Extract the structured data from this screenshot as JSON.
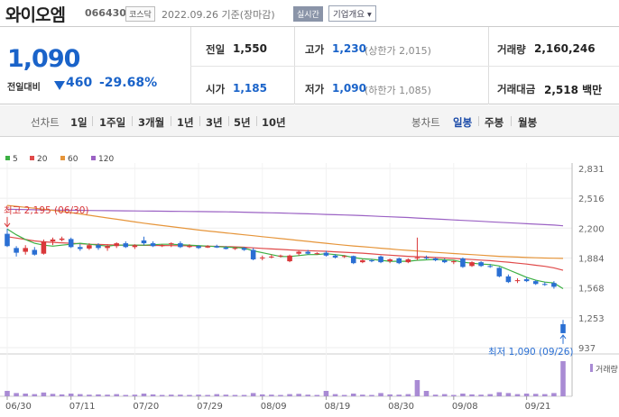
{
  "header": {
    "stock_name": "와이오엠",
    "stock_code": "066430",
    "market": "코스닥",
    "trade_date": "2022.09.26 기준(장마감)",
    "realtime_label": "실시간",
    "overview_label": "기업개요 ▾"
  },
  "quote": {
    "price": "1,090",
    "change_label": "전일대비",
    "change_amount": "460",
    "change_rate": "-29.68%",
    "prev_close_label": "전일",
    "prev_close": "1,550",
    "high_label": "고가",
    "high": "1,230",
    "upper_limit": "(상한가 2,015)",
    "volume_label": "거래량",
    "volume": "2,160,246",
    "open_label": "시가",
    "open": "1,185",
    "low_label": "저가",
    "low": "1,090",
    "lower_limit": "(하한가 1,085)",
    "trade_value_label": "거래대금",
    "trade_value": "2,518 백만"
  },
  "toolbar": {
    "line_chart_label": "선차트",
    "periods": [
      "1일",
      "1주일",
      "3개월",
      "1년",
      "3년",
      "5년",
      "10년"
    ],
    "candle_chart_label": "봉차트",
    "candle_periods": [
      "일봉",
      "주봉",
      "월봉"
    ],
    "active_candle_period": "일봉"
  },
  "colors": {
    "up": "#d9383a",
    "down": "#2a6fd3",
    "ma5": "#3cb043",
    "ma20": "#e04a4a",
    "ma60": "#e6953a",
    "ma120": "#9b62c4",
    "volume": "#a98bd4",
    "accent": "#1a63c9"
  },
  "chart_data": {
    "type": "candlestick",
    "legend": [
      {
        "name": "5",
        "color": "#3cb043"
      },
      {
        "name": "20",
        "color": "#e04a4a"
      },
      {
        "name": "60",
        "color": "#e6953a"
      },
      {
        "name": "120",
        "color": "#9b62c4"
      }
    ],
    "ylim": [
      937,
      2831
    ],
    "y_ticks": [
      "2,831",
      "2,516",
      "2,200",
      "1,884",
      "1,568",
      "1,253",
      "937"
    ],
    "y_tick_values": [
      2831,
      2516,
      2200,
      1884,
      1568,
      1253,
      937
    ],
    "x_tick_labels": [
      "06/30",
      "07/11",
      "07/20",
      "07/29",
      "08/09",
      "08/19",
      "08/30",
      "09/08",
      "09/21"
    ],
    "x_tick_index": [
      0,
      7,
      14,
      21,
      28,
      35,
      42,
      49,
      57
    ],
    "high_annotation": "최고 2,195 (06/30)",
    "low_annotation": "최저 1,090 (09/26)",
    "volume_legend": "거래량",
    "candles": [
      {
        "o": 2140,
        "h": 2195,
        "l": 2000,
        "c": 2010
      },
      {
        "o": 1990,
        "h": 2010,
        "l": 1900,
        "c": 1940
      },
      {
        "o": 1950,
        "h": 2020,
        "l": 1920,
        "c": 1990
      },
      {
        "o": 1970,
        "h": 2000,
        "l": 1910,
        "c": 1920
      },
      {
        "o": 1930,
        "h": 2080,
        "l": 1920,
        "c": 2060
      },
      {
        "o": 2060,
        "h": 2100,
        "l": 2020,
        "c": 2080
      },
      {
        "o": 2075,
        "h": 2110,
        "l": 2060,
        "c": 2090
      },
      {
        "o": 2085,
        "h": 2100,
        "l": 1990,
        "c": 2000
      },
      {
        "o": 2000,
        "h": 2030,
        "l": 1960,
        "c": 1980
      },
      {
        "o": 1985,
        "h": 2040,
        "l": 1970,
        "c": 2020
      },
      {
        "o": 2020,
        "h": 2040,
        "l": 1970,
        "c": 1990
      },
      {
        "o": 1990,
        "h": 2030,
        "l": 1960,
        "c": 2010
      },
      {
        "o": 2010,
        "h": 2050,
        "l": 1990,
        "c": 2040
      },
      {
        "o": 2040,
        "h": 2060,
        "l": 1990,
        "c": 2000
      },
      {
        "o": 2000,
        "h": 2030,
        "l": 1980,
        "c": 2020
      },
      {
        "o": 2070,
        "h": 2110,
        "l": 2020,
        "c": 2040
      },
      {
        "o": 2040,
        "h": 2060,
        "l": 2000,
        "c": 2010
      },
      {
        "o": 2010,
        "h": 2030,
        "l": 2000,
        "c": 2020
      },
      {
        "o": 2030,
        "h": 2050,
        "l": 2000,
        "c": 2040
      },
      {
        "o": 2040,
        "h": 2060,
        "l": 1990,
        "c": 2000
      },
      {
        "o": 2000,
        "h": 2030,
        "l": 1990,
        "c": 2010
      },
      {
        "o": 2010,
        "h": 2020,
        "l": 1980,
        "c": 1990
      },
      {
        "o": 1995,
        "h": 2020,
        "l": 1990,
        "c": 2010
      },
      {
        "o": 2010,
        "h": 2025,
        "l": 1990,
        "c": 1995
      },
      {
        "o": 1995,
        "h": 2010,
        "l": 1975,
        "c": 1980
      },
      {
        "o": 1985,
        "h": 2000,
        "l": 1970,
        "c": 1990
      },
      {
        "o": 1990,
        "h": 2000,
        "l": 1960,
        "c": 1970
      },
      {
        "o": 1970,
        "h": 1990,
        "l": 1860,
        "c": 1870
      },
      {
        "o": 1880,
        "h": 1910,
        "l": 1860,
        "c": 1890
      },
      {
        "o": 1890,
        "h": 1920,
        "l": 1880,
        "c": 1900
      },
      {
        "o": 1905,
        "h": 1920,
        "l": 1890,
        "c": 1910
      },
      {
        "o": 1850,
        "h": 1920,
        "l": 1840,
        "c": 1910
      },
      {
        "o": 1930,
        "h": 1960,
        "l": 1910,
        "c": 1950
      },
      {
        "o": 1950,
        "h": 1970,
        "l": 1920,
        "c": 1930
      },
      {
        "o": 1930,
        "h": 1945,
        "l": 1920,
        "c": 1935
      },
      {
        "o": 1940,
        "h": 1960,
        "l": 1900,
        "c": 1910
      },
      {
        "o": 1910,
        "h": 1925,
        "l": 1880,
        "c": 1890
      },
      {
        "o": 1900,
        "h": 1915,
        "l": 1885,
        "c": 1905
      },
      {
        "o": 1905,
        "h": 1910,
        "l": 1820,
        "c": 1830
      },
      {
        "o": 1840,
        "h": 1870,
        "l": 1830,
        "c": 1860
      },
      {
        "o": 1860,
        "h": 1875,
        "l": 1840,
        "c": 1850
      },
      {
        "o": 1900,
        "h": 1910,
        "l": 1830,
        "c": 1840
      },
      {
        "o": 1850,
        "h": 1880,
        "l": 1830,
        "c": 1870
      },
      {
        "o": 1880,
        "h": 1890,
        "l": 1820,
        "c": 1830
      },
      {
        "o": 1840,
        "h": 1880,
        "l": 1830,
        "c": 1870
      },
      {
        "o": 1880,
        "h": 2100,
        "l": 1860,
        "c": 1890
      },
      {
        "o": 1890,
        "h": 1910,
        "l": 1870,
        "c": 1880
      },
      {
        "o": 1880,
        "h": 1890,
        "l": 1850,
        "c": 1860
      },
      {
        "o": 1860,
        "h": 1880,
        "l": 1830,
        "c": 1840
      },
      {
        "o": 1840,
        "h": 1860,
        "l": 1820,
        "c": 1850
      },
      {
        "o": 1880,
        "h": 1890,
        "l": 1780,
        "c": 1790
      },
      {
        "o": 1800,
        "h": 1850,
        "l": 1790,
        "c": 1840
      },
      {
        "o": 1840,
        "h": 1850,
        "l": 1790,
        "c": 1800
      },
      {
        "o": 1800,
        "h": 1820,
        "l": 1780,
        "c": 1790
      },
      {
        "o": 1780,
        "h": 1790,
        "l": 1680,
        "c": 1690
      },
      {
        "o": 1690,
        "h": 1710,
        "l": 1620,
        "c": 1630
      },
      {
        "o": 1640,
        "h": 1670,
        "l": 1620,
        "c": 1650
      },
      {
        "o": 1660,
        "h": 1680,
        "l": 1630,
        "c": 1640
      },
      {
        "o": 1640,
        "h": 1650,
        "l": 1600,
        "c": 1610
      },
      {
        "o": 1610,
        "h": 1630,
        "l": 1590,
        "c": 1600
      },
      {
        "o": 1620,
        "h": 1640,
        "l": 1560,
        "c": 1580
      },
      {
        "o": 1185,
        "h": 1230,
        "l": 1090,
        "c": 1090
      }
    ],
    "ma5": [
      2190,
      2130,
      2080,
      2040,
      2020,
      2010,
      2020,
      2030,
      2040,
      2030,
      2020,
      2010,
      2020,
      2020,
      2020,
      2020,
      2025,
      2030,
      2030,
      2025,
      2020,
      2015,
      2010,
      2005,
      2000,
      1995,
      1990,
      1960,
      1940,
      1920,
      1900,
      1900,
      1910,
      1920,
      1920,
      1930,
      1920,
      1910,
      1890,
      1875,
      1870,
      1860,
      1850,
      1850,
      1850,
      1860,
      1865,
      1870,
      1865,
      1860,
      1840,
      1830,
      1820,
      1815,
      1800,
      1760,
      1720,
      1680,
      1650,
      1630,
      1620,
      1560
    ],
    "ma20": [
      2110,
      2095,
      2080,
      2065,
      2055,
      2050,
      2045,
      2040,
      2035,
      2030,
      2028,
      2025,
      2022,
      2020,
      2020,
      2018,
      2017,
      2016,
      2015,
      2014,
      2013,
      2012,
      2010,
      2008,
      2005,
      2002,
      1998,
      1992,
      1986,
      1980,
      1975,
      1970,
      1965,
      1962,
      1958,
      1955,
      1950,
      1945,
      1940,
      1935,
      1928,
      1920,
      1914,
      1908,
      1902,
      1898,
      1894,
      1890,
      1885,
      1880,
      1874,
      1868,
      1862,
      1856,
      1848,
      1840,
      1830,
      1820,
      1808,
      1796,
      1780,
      1755
    ],
    "ma60": [
      2440,
      2430,
      2420,
      2410,
      2400,
      2388,
      2376,
      2364,
      2350,
      2336,
      2322,
      2308,
      2294,
      2280,
      2266,
      2252,
      2240,
      2228,
      2216,
      2204,
      2192,
      2180,
      2170,
      2160,
      2150,
      2140,
      2130,
      2120,
      2110,
      2100,
      2090,
      2080,
      2070,
      2060,
      2050,
      2040,
      2030,
      2020,
      2012,
      2004,
      1996,
      1988,
      1980,
      1972,
      1965,
      1958,
      1951,
      1944,
      1938,
      1932,
      1926,
      1920,
      1914,
      1908,
      1902,
      1898,
      1894,
      1890,
      1887,
      1884,
      1882,
      1880
    ],
    "ma120": [
      2400,
      2398,
      2396,
      2394,
      2392,
      2391,
      2390,
      2389,
      2388,
      2387,
      2386,
      2385,
      2384,
      2383,
      2382,
      2381,
      2380,
      2379,
      2378,
      2377,
      2376,
      2375,
      2374,
      2373,
      2372,
      2370,
      2368,
      2366,
      2364,
      2362,
      2360,
      2357,
      2354,
      2351,
      2348,
      2345,
      2342,
      2339,
      2336,
      2332,
      2328,
      2324,
      2320,
      2316,
      2312,
      2307,
      2302,
      2297,
      2292,
      2287,
      2282,
      2277,
      2272,
      2267,
      2262,
      2257,
      2252,
      2247,
      2242,
      2237,
      2232,
      2225
    ],
    "volume": [
      20,
      12,
      10,
      8,
      14,
      9,
      7,
      10,
      8,
      6,
      7,
      6,
      8,
      5,
      6,
      10,
      7,
      5,
      6,
      6,
      5,
      6,
      5,
      8,
      6,
      5,
      5,
      12,
      7,
      6,
      5,
      8,
      9,
      6,
      5,
      20,
      8,
      5,
      10,
      6,
      5,
      12,
      7,
      6,
      8,
      60,
      20,
      6,
      8,
      5,
      10,
      7,
      6,
      8,
      15,
      12,
      8,
      10,
      9,
      8,
      12,
      130
    ]
  }
}
